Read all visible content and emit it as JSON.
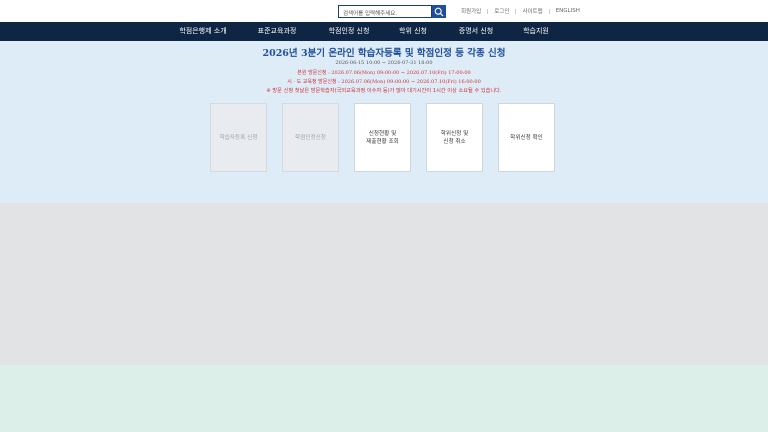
{
  "search": {
    "placeholder": "검색어를 입력해주세요."
  },
  "util_links": [
    "회원가입",
    "로그인",
    "사이트맵",
    "ENGLISH"
  ],
  "nav": [
    "학점은행제 소개",
    "표준교육과정",
    "학점인정 신청",
    "학위 신청",
    "증명서 신청",
    "학습지원"
  ],
  "notice": {
    "title": "2026년 3분기 온라인 학습자등록 및 학점인정 등 각종 신청",
    "period": "2026-06-15 10:00 ~ 2026-07-31 18:00",
    "visit_hq": "본원 방문신청 : 2026.07.06(Mon) 09:00:00 ~ 2026.07.10(Fri) 17:00:00",
    "visit_local": "시 · 도 교육청 방문신청 : 2026.07.06(Mon) 09:00:00 ~ 2026.07.10(Fri) 16:00:00",
    "warning": "※ 방문 신청 첫날은 방문학습자(국외교육과정 이수자 등)가 많아 대기시간이 1시간 이상 소요될 수 있습니다."
  },
  "cards": [
    {
      "label": "학습자등록 신청",
      "disabled": true
    },
    {
      "label": "학점인정신청",
      "disabled": true
    },
    {
      "label": "신청현황 및\n제출현황 조회",
      "disabled": false
    },
    {
      "label": "학위신청 및\n신청 취소",
      "disabled": false
    },
    {
      "label": "학위신청 확인",
      "disabled": false
    }
  ],
  "colors": {
    "nav_bg": "#0f2544",
    "accent": "#1f4f9c",
    "alert": "#d32f2f",
    "content_bg": "#deecf8"
  }
}
